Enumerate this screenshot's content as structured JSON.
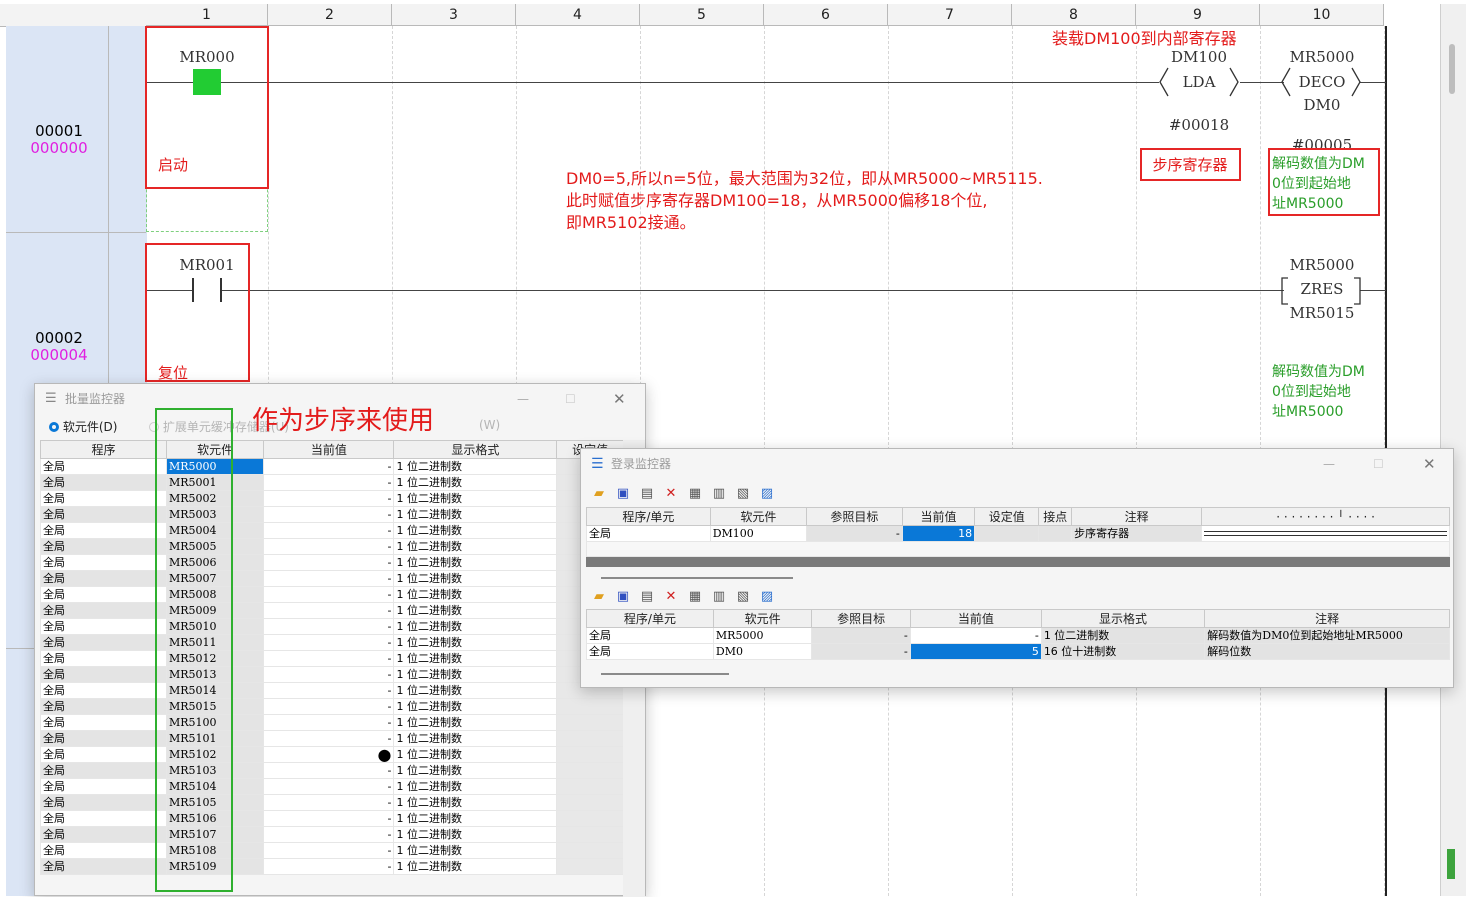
{
  "columns": [
    "1",
    "2",
    "3",
    "4",
    "5",
    "6",
    "7",
    "8",
    "9",
    "10"
  ],
  "rungs": [
    {
      "step": "00001",
      "addr": "000000"
    },
    {
      "step": "00002",
      "addr": "000004"
    }
  ],
  "rung1": {
    "contact": "MR000",
    "contact_comment": "启动",
    "lda_operand": "DM100",
    "lda_instr": "LDA",
    "lda_value": "#00018",
    "lda_comment": "步序寄存器",
    "lda_note": "装载DM100到内部寄存器",
    "deco_operand": "MR5000",
    "deco_instr": "DECO",
    "deco_operand2": "DM0",
    "deco_value": "#00005",
    "deco_comment": "解码数值为DM\n0位到起始地\n址MR5000"
  },
  "rung2": {
    "contact": "MR001",
    "contact_comment": "复位",
    "zres_operand": "MR5000",
    "zres_instr": "ZRES",
    "zres_operand2": "MR5015",
    "zres_comment": "解码数值为DM\n0位到起始地\n址MR5000"
  },
  "annotation": {
    "line1": "DM0=5,所以n=5位，最大范围为32位，即从MR5000~MR5115.",
    "line2": "此时赋值步序寄存器DM100=18，从MR5000偏移18个位,",
    "line3": "即MR5102接通。",
    "usage": "作为步序来使用"
  },
  "batch_monitor": {
    "title": "批量监控器",
    "radio1": "软元件(D)",
    "radio2": "扩展单元缓冲存储器(U)",
    "radio3": "(W)",
    "headers": [
      "程序",
      "软元件",
      "当前值",
      "显示格式",
      "设定值"
    ],
    "rows": [
      {
        "prog": "全局",
        "dev": "MR5000",
        "val": "-",
        "fmt": "1 位二进制数"
      },
      {
        "prog": "全局",
        "dev": "MR5001",
        "val": "-",
        "fmt": "1 位二进制数"
      },
      {
        "prog": "全局",
        "dev": "MR5002",
        "val": "-",
        "fmt": "1 位二进制数"
      },
      {
        "prog": "全局",
        "dev": "MR5003",
        "val": "-",
        "fmt": "1 位二进制数"
      },
      {
        "prog": "全局",
        "dev": "MR5004",
        "val": "-",
        "fmt": "1 位二进制数"
      },
      {
        "prog": "全局",
        "dev": "MR5005",
        "val": "-",
        "fmt": "1 位二进制数"
      },
      {
        "prog": "全局",
        "dev": "MR5006",
        "val": "-",
        "fmt": "1 位二进制数"
      },
      {
        "prog": "全局",
        "dev": "MR5007",
        "val": "-",
        "fmt": "1 位二进制数"
      },
      {
        "prog": "全局",
        "dev": "MR5008",
        "val": "-",
        "fmt": "1 位二进制数"
      },
      {
        "prog": "全局",
        "dev": "MR5009",
        "val": "-",
        "fmt": "1 位二进制数"
      },
      {
        "prog": "全局",
        "dev": "MR5010",
        "val": "-",
        "fmt": "1 位二进制数"
      },
      {
        "prog": "全局",
        "dev": "MR5011",
        "val": "-",
        "fmt": "1 位二进制数"
      },
      {
        "prog": "全局",
        "dev": "MR5012",
        "val": "-",
        "fmt": "1 位二进制数"
      },
      {
        "prog": "全局",
        "dev": "MR5013",
        "val": "-",
        "fmt": "1 位二进制数"
      },
      {
        "prog": "全局",
        "dev": "MR5014",
        "val": "-",
        "fmt": "1 位二进制数"
      },
      {
        "prog": "全局",
        "dev": "MR5015",
        "val": "-",
        "fmt": "1 位二进制数"
      },
      {
        "prog": "全局",
        "dev": "MR5100",
        "val": "-",
        "fmt": "1 位二进制数"
      },
      {
        "prog": "全局",
        "dev": "MR5101",
        "val": "-",
        "fmt": "1 位二进制数"
      },
      {
        "prog": "全局",
        "dev": "MR5102",
        "val": "●",
        "fmt": "1 位二进制数"
      },
      {
        "prog": "全局",
        "dev": "MR5103",
        "val": "-",
        "fmt": "1 位二进制数"
      },
      {
        "prog": "全局",
        "dev": "MR5104",
        "val": "-",
        "fmt": "1 位二进制数"
      },
      {
        "prog": "全局",
        "dev": "MR5105",
        "val": "-",
        "fmt": "1 位二进制数"
      },
      {
        "prog": "全局",
        "dev": "MR5106",
        "val": "-",
        "fmt": "1 位二进制数"
      },
      {
        "prog": "全局",
        "dev": "MR5107",
        "val": "-",
        "fmt": "1 位二进制数"
      },
      {
        "prog": "全局",
        "dev": "MR5108",
        "val": "-",
        "fmt": "1 位二进制数"
      },
      {
        "prog": "全局",
        "dev": "MR5109",
        "val": "-",
        "fmt": "1 位二进制数"
      }
    ]
  },
  "reg_monitor": {
    "title": "登录监控器",
    "headers1": [
      "程序/单元",
      "软元件",
      "参照目标",
      "当前值",
      "设定值",
      "接点",
      "注释"
    ],
    "row1": {
      "prog": "全局",
      "dev": "DM100",
      "ref": "-",
      "val": "18",
      "comment": "步序寄存器"
    },
    "headers2": [
      "程序/单元",
      "软元件",
      "参照目标",
      "当前值",
      "显示格式",
      "注释"
    ],
    "rows2": [
      {
        "prog": "全局",
        "dev": "MR5000",
        "ref": "-",
        "val": "-",
        "fmt": "1 位二进制数",
        "comment": "解码数值为DM0位到起始地址MR5000"
      },
      {
        "prog": "全局",
        "dev": "DM0",
        "ref": "-",
        "val": "5",
        "fmt": "16 位十进制数",
        "comment": "解码位数"
      }
    ]
  },
  "colors": {
    "accent": "#0a78d7",
    "annotation": "#e31b1b",
    "comment": "#2a9e2a",
    "step_label": "#dbe5f5",
    "contact_on": "#22cc33"
  }
}
